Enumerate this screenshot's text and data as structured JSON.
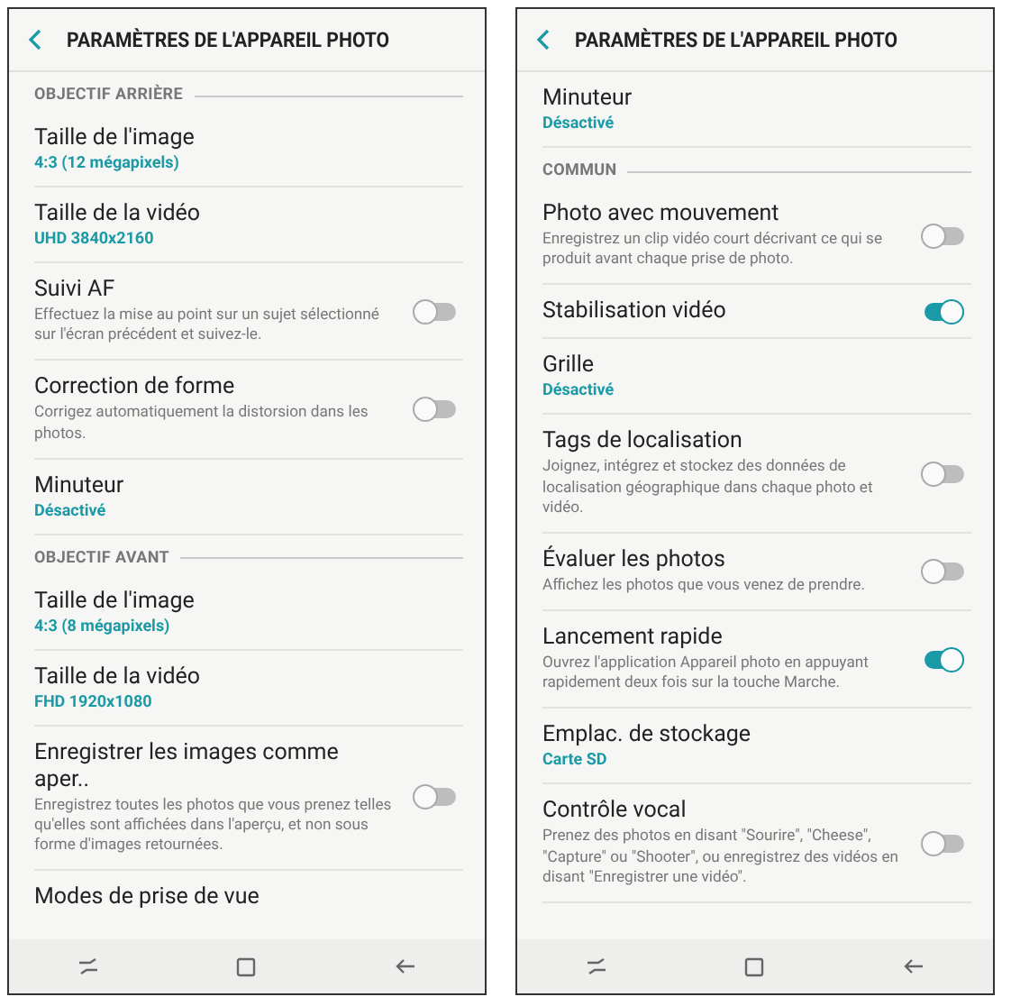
{
  "screens": [
    {
      "title": "PARAMÈTRES DE L'APPAREIL PHOTO",
      "items": [
        {
          "kind": "section",
          "label": "OBJECTIF ARRIÈRE"
        },
        {
          "kind": "value",
          "title": "Taille de l'image",
          "value": "4:3 (12 mégapixels)"
        },
        {
          "kind": "value",
          "title": "Taille de la vidéo",
          "value": "UHD 3840x2160"
        },
        {
          "kind": "toggle",
          "title": "Suivi AF",
          "description": "Effectuez la mise au point sur un sujet sélectionné sur l'écran précédent et suivez-le.",
          "on": false
        },
        {
          "kind": "toggle",
          "title": "Correction de forme",
          "description": "Corrigez automatiquement la distorsion dans les photos.",
          "on": false
        },
        {
          "kind": "value",
          "title": "Minuteur",
          "value": "Désactivé"
        },
        {
          "kind": "section",
          "label": "OBJECTIF AVANT"
        },
        {
          "kind": "value",
          "title": "Taille de l'image",
          "value": "4:3 (8 mégapixels)"
        },
        {
          "kind": "value",
          "title": "Taille de la vidéo",
          "value": "FHD 1920x1080"
        },
        {
          "kind": "toggle",
          "title": "Enregistrer les images comme aper..",
          "description": "Enregistrez toutes les photos que vous prenez telles qu'elles sont affichées dans l'aperçu, et non sous forme d'images retournées.",
          "on": false
        },
        {
          "kind": "plain",
          "title": "Modes de prise de vue"
        }
      ]
    },
    {
      "title": "PARAMÈTRES DE L'APPAREIL PHOTO",
      "items": [
        {
          "kind": "value",
          "title": "Minuteur",
          "value": "Désactivé"
        },
        {
          "kind": "section",
          "label": "COMMUN"
        },
        {
          "kind": "toggle",
          "title": "Photo avec mouvement",
          "description": "Enregistrez un clip vidéo court décrivant ce qui se produit avant chaque prise de photo.",
          "on": false
        },
        {
          "kind": "toggle",
          "title": "Stabilisation vidéo",
          "on": true
        },
        {
          "kind": "value",
          "title": "Grille",
          "value": "Désactivé"
        },
        {
          "kind": "toggle",
          "title": "Tags de localisation",
          "description": "Joignez, intégrez et stockez des données de localisation géographique dans chaque photo et vidéo.",
          "on": false
        },
        {
          "kind": "toggle",
          "title": "Évaluer les photos",
          "description": "Affichez les photos que vous venez de prendre.",
          "on": false
        },
        {
          "kind": "toggle",
          "title": "Lancement rapide",
          "description": "Ouvrez l'application Appareil photo en appuyant rapidement deux fois sur la touche Marche.",
          "on": true
        },
        {
          "kind": "value",
          "title": "Emplac. de stockage",
          "value": "Carte SD"
        },
        {
          "kind": "toggle",
          "title": "Contrôle vocal",
          "description": "Prenez des photos en disant \"Sourire\", \"Cheese\", \"Capture\" ou \"Shooter\", ou enregistrez des vidéos en disant \"Enregistrer une vidéo\".",
          "on": false
        }
      ]
    }
  ]
}
